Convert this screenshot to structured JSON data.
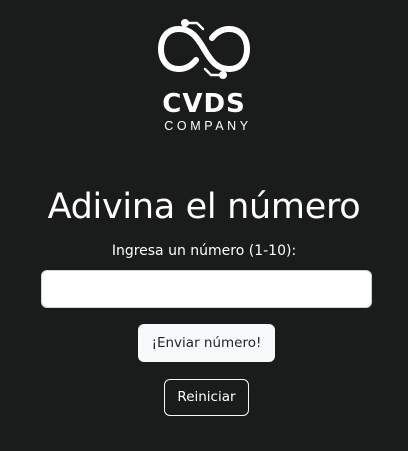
{
  "brand": {
    "name": "CVDS",
    "subtitle": "COMPANY",
    "logo_icon": "circuit-infinity-icon"
  },
  "game": {
    "title": "Adivina el número",
    "prompt": "Ingresa un número (1-10):",
    "input_value": "",
    "input_placeholder": "",
    "submit_label": "¡Enviar número!",
    "reset_label": "Reiniciar"
  },
  "colors": {
    "background": "#1a1b1b",
    "text": "#ffffff",
    "button_light": "#f8f9fa"
  }
}
